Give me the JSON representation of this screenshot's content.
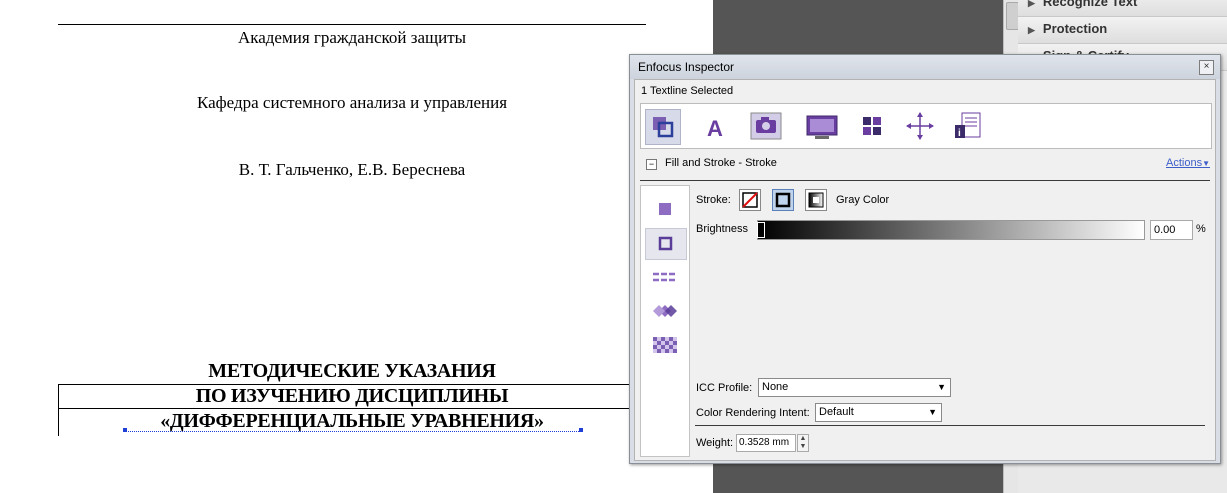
{
  "document": {
    "org": "Академия гражданской защиты",
    "department": "Кафедра системного анализа и управления",
    "authors": "В. Т. Гальченко, Е.В. Береснева",
    "heading_line1": "МЕТОДИЧЕСКИЕ УКАЗАНИЯ",
    "heading_line2": "ПО ИЗУЧЕНИЮ ДИСЦИПЛИНЫ",
    "heading_line3": "«ДИФФЕРЕНЦИАЛЬНЫЕ УРАВНЕНИЯ»"
  },
  "tools_panel": {
    "items": [
      "Recognize Text",
      "Protection",
      "Sign & Certify"
    ]
  },
  "inspector": {
    "title": "Enfocus Inspector",
    "close_label": "×",
    "selection": "1 Textline Selected",
    "tabs": [
      "fill-stroke-icon",
      "text-icon",
      "image-icon",
      "monitor-icon",
      "grid-icon",
      "position-icon",
      "document-info-icon"
    ],
    "section_title": "Fill and Stroke - Stroke",
    "actions_label": "Actions",
    "stroke_label": "Stroke:",
    "color_mode": "Gray Color",
    "brightness_label": "Brightness",
    "brightness_value": "0.00",
    "brightness_level": 0,
    "brightness_unit": "%",
    "icc_label": "ICC Profile:",
    "icc_value": "None",
    "intent_label": "Color Rendering Intent:",
    "intent_value": "Default",
    "weight_label": "Weight:",
    "weight_value": "0.3528 mm"
  },
  "colors": {
    "accent_purple": "#6a3ea1",
    "dark_gap": "#555555",
    "link_blue": "#3c5ec8"
  }
}
